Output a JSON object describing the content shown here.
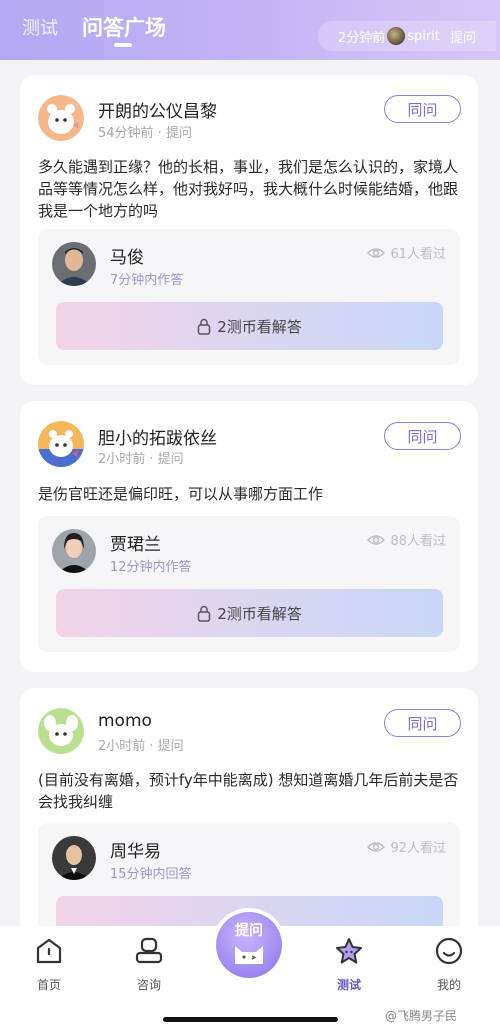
{
  "header": {
    "tabs": [
      "测试",
      "问答广场"
    ],
    "ticker": {
      "time": "2分钟前",
      "user": "spirit",
      "action": "提问"
    }
  },
  "cards": [
    {
      "name": "开朗的公仪昌黎",
      "meta": "54分钟前 · 提问",
      "same_q": "同问",
      "question": "多久能遇到正缘？他的长相，事业，我们是怎么认识的，家境人品等等情况怎么样，他对我好吗，我大概什么时候能结婚，他跟我是一个地方的吗",
      "answer": {
        "name": "马俊",
        "time": "7分钟内作答",
        "views": "61人看过",
        "unlock": "2测币看解答"
      }
    },
    {
      "name": "胆小的拓跋依丝",
      "meta": "2小时前 · 提问",
      "same_q": "同问",
      "question": "是伤官旺还是偏印旺，可以从事哪方面工作",
      "answer": {
        "name": "贾珺兰",
        "time": "12分钟内作答",
        "views": "88人看过",
        "unlock": "2测币看解答"
      }
    },
    {
      "name": "momo",
      "meta": "2小时前 · 提问",
      "same_q": "同问",
      "question": "(目前没有离婚，预计fy年中能离成) 想知道离婚几年后前夫是否会找我纠缠",
      "answer": {
        "name": "周华易",
        "time": "15分钟内回答",
        "views": "92人看过",
        "unlock": ""
      }
    }
  ],
  "nav": {
    "home": "首页",
    "consult": "咨询",
    "ask": "提问",
    "test": "测试",
    "mine": "我的"
  },
  "watermark": "@飞腾男子民",
  "colors": {
    "accent": "#8f7fe3",
    "header": "#b3a8f3"
  }
}
